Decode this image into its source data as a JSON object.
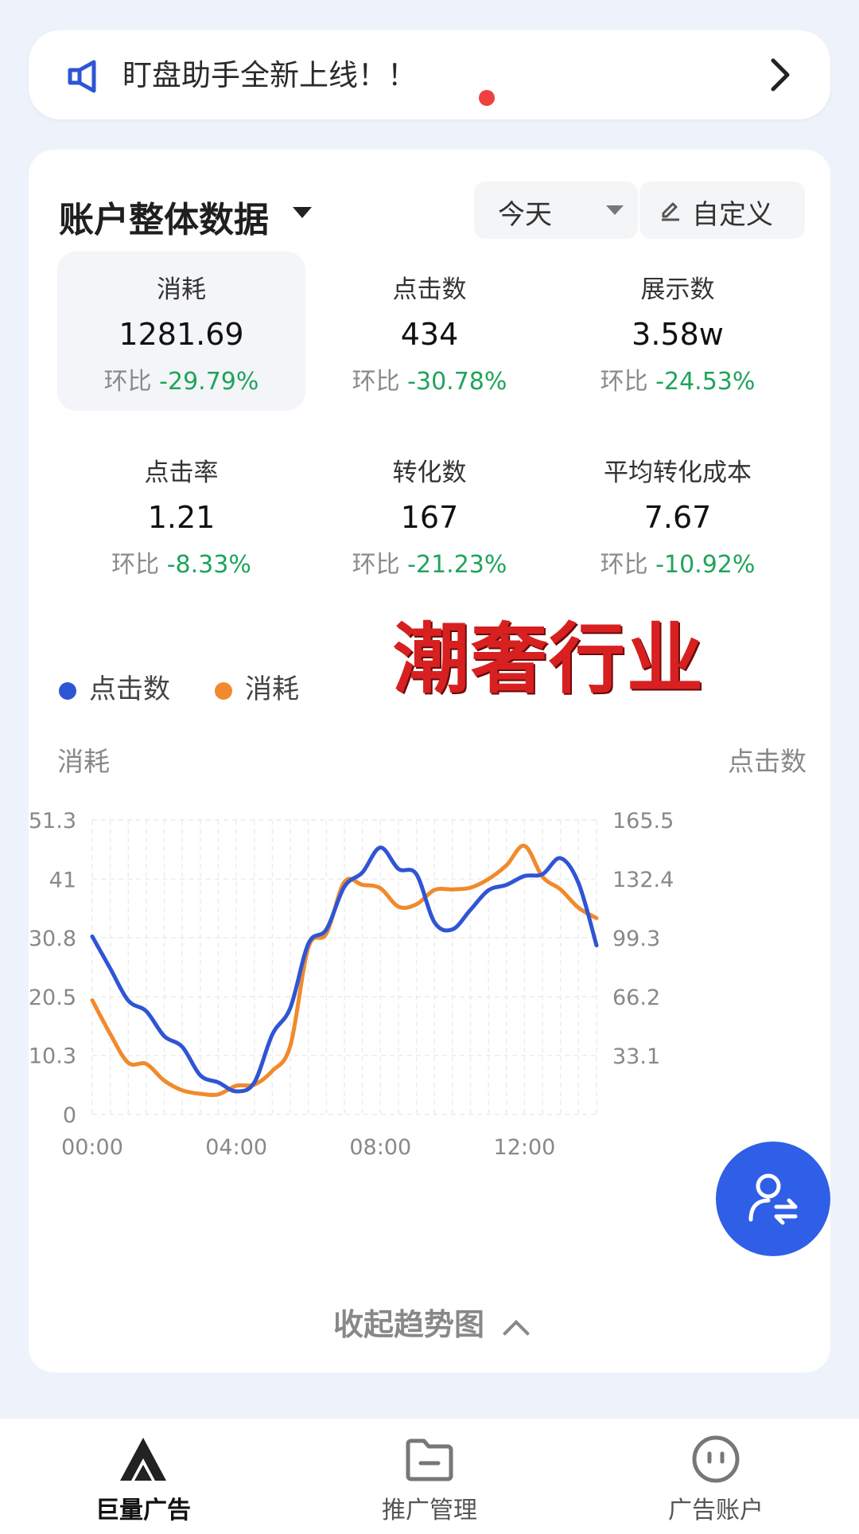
{
  "notice": {
    "text": "盯盘助手全新上线！！"
  },
  "card": {
    "title": "账户整体数据",
    "date_filter": "今天",
    "custom_label": "自定义",
    "compare_prefix": "环比",
    "metrics": [
      {
        "label": "消耗",
        "value": "1281.69",
        "change": "-29.79%"
      },
      {
        "label": "点击数",
        "value": "434",
        "change": "-30.78%"
      },
      {
        "label": "展示数",
        "value": "3.58w",
        "change": "-24.53%"
      },
      {
        "label": "点击率",
        "value": "1.21",
        "change": "-8.33%"
      },
      {
        "label": "转化数",
        "value": "167",
        "change": "-21.23%"
      },
      {
        "label": "平均转化成本",
        "value": "7.67",
        "change": "-10.92%"
      }
    ],
    "stamp": "潮奢行业",
    "collapse_label": "收起趋势图"
  },
  "chart_data": {
    "type": "line",
    "left_axis_label": "消耗",
    "right_axis_label": "点击数",
    "left_ticks": [
      "51.3",
      "41",
      "30.8",
      "20.5",
      "10.3",
      "0"
    ],
    "right_ticks": [
      "165.5",
      "132.4",
      "99.3",
      "66.2",
      "33.1"
    ],
    "x_ticks": [
      "00:00",
      "04:00",
      "08:00",
      "12:00"
    ],
    "left_ylim": [
      0,
      51.3
    ],
    "right_ylim": [
      0,
      165.5
    ],
    "x_range_hours": [
      0,
      14
    ],
    "grid": true,
    "series": [
      {
        "name": "点击数",
        "axis": "right",
        "color": "#2f55d4",
        "x": [
          0,
          0.5,
          1,
          1.5,
          2,
          2.5,
          3,
          3.5,
          4,
          4.5,
          5,
          5.5,
          6,
          6.5,
          7,
          7.5,
          8,
          8.5,
          9,
          9.5,
          10,
          10.5,
          11,
          11.5,
          12,
          12.5,
          13,
          13.5,
          14
        ],
        "values": [
          100,
          82,
          64,
          58,
          44,
          38,
          22,
          18,
          13,
          18,
          45,
          60,
          96,
          104,
          128,
          136,
          150,
          138,
          135,
          108,
          104,
          115,
          126,
          129,
          134,
          135,
          144,
          130,
          95
        ]
      },
      {
        "name": "消耗",
        "axis": "left",
        "color": "#f08a2c",
        "x": [
          0,
          0.5,
          1,
          1.5,
          2,
          2.5,
          3,
          3.5,
          4,
          4.5,
          5,
          5.5,
          6,
          6.5,
          7,
          7.5,
          8,
          8.5,
          9,
          9.5,
          10,
          10.5,
          11,
          11.5,
          12,
          12.5,
          13,
          13.5,
          14
        ],
        "values": [
          19.9,
          14,
          9,
          8.8,
          5.9,
          4.2,
          3.6,
          3.5,
          5,
          5.2,
          7.6,
          12,
          29.1,
          31.5,
          40.5,
          40,
          39.4,
          36.2,
          36.6,
          39.1,
          39.2,
          39.5,
          41,
          43.4,
          46.8,
          41.4,
          39.2,
          36,
          34.2
        ]
      }
    ]
  },
  "legend": [
    {
      "name": "点击数",
      "color": "#2f55d4"
    },
    {
      "name": "消耗",
      "color": "#f08a2c"
    }
  ],
  "nav": [
    {
      "label": "巨量广告",
      "icon": "brand-logo-icon",
      "active": true
    },
    {
      "label": "推广管理",
      "icon": "folder-icon",
      "active": false
    },
    {
      "label": "广告账户",
      "icon": "account-face-icon",
      "active": false
    }
  ]
}
